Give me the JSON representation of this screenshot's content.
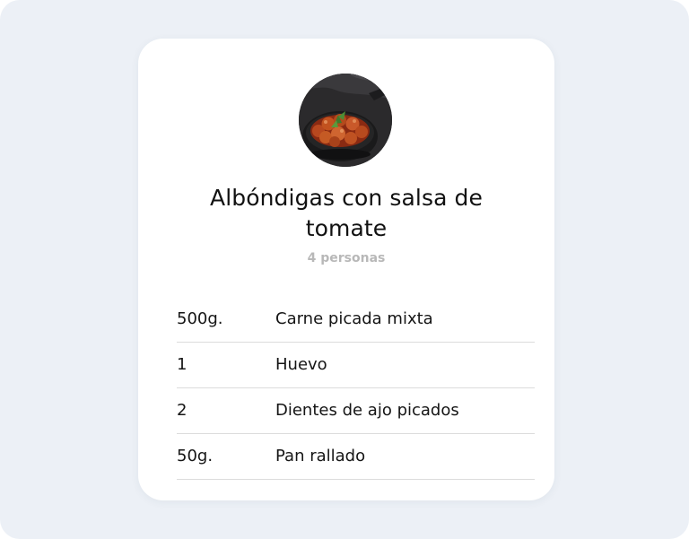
{
  "recipe": {
    "photo_icon": "meatballs-in-pan-photo",
    "title": "Albóndigas con salsa de tomate",
    "servings": "4 personas",
    "ingredients": [
      {
        "qty": "500g.",
        "name": "Carne picada mixta"
      },
      {
        "qty": "1",
        "name": "Huevo"
      },
      {
        "qty": "2",
        "name": "Dientes de ajo picados"
      },
      {
        "qty": "50g.",
        "name": "Pan rallado"
      }
    ]
  },
  "colors": {
    "background": "#ecf0f6",
    "card": "#ffffff",
    "title_text": "#111111",
    "muted_text": "#b8b8b8",
    "divider": "#dcdcdc"
  }
}
